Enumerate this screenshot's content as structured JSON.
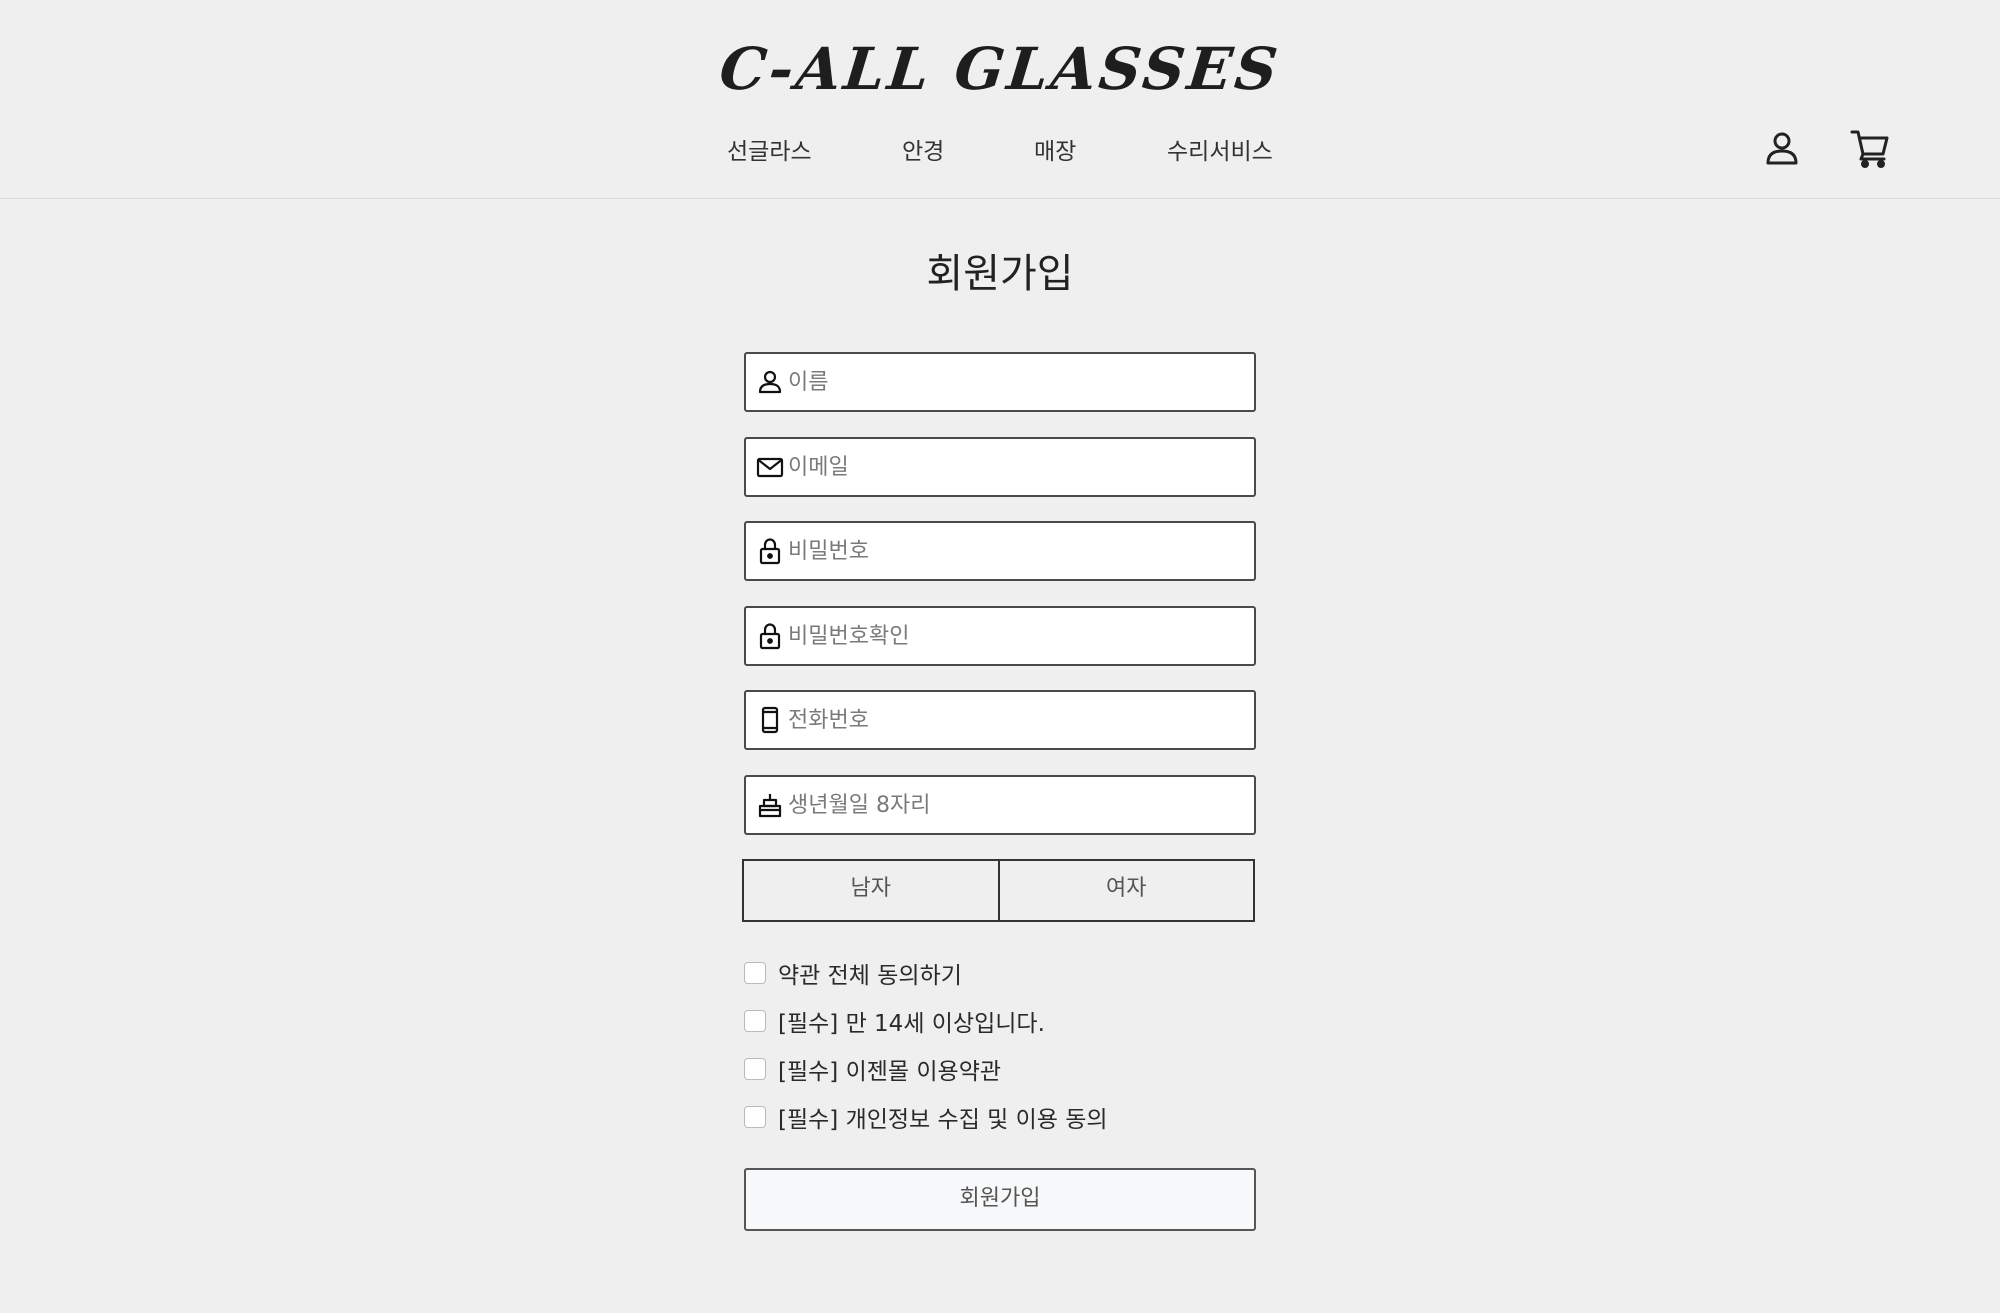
{
  "header": {
    "logo_text": "C-ALL GLASSES",
    "nav": [
      {
        "label": "선글라스"
      },
      {
        "label": "안경"
      },
      {
        "label": "매장"
      },
      {
        "label": "수리서비스"
      }
    ],
    "icons": {
      "user": "user-icon",
      "cart": "cart-icon"
    }
  },
  "page": {
    "title": "회원가입"
  },
  "form": {
    "fields": [
      {
        "icon": "person-icon",
        "placeholder": "이름",
        "value": ""
      },
      {
        "icon": "mail-icon",
        "placeholder": "이메일",
        "value": ""
      },
      {
        "icon": "lock-icon",
        "placeholder": "비밀번호",
        "value": ""
      },
      {
        "icon": "lock-icon",
        "placeholder": "비밀번호확인",
        "value": ""
      },
      {
        "icon": "phone-icon",
        "placeholder": "전화번호",
        "value": ""
      },
      {
        "icon": "cake-icon",
        "placeholder": "생년월일 8자리",
        "value": ""
      }
    ],
    "gender": {
      "male": "남자",
      "female": "여자"
    },
    "agreements": [
      {
        "label": "약관 전체 동의하기",
        "checked": false
      },
      {
        "label": "[필수] 만 14세 이상입니다.",
        "checked": false
      },
      {
        "label": "[필수] 이젠몰 이용약관",
        "checked": false
      },
      {
        "label": "[필수] 개인정보 수집 및 이용 동의",
        "checked": false
      }
    ],
    "submit_label": "회원가입"
  }
}
